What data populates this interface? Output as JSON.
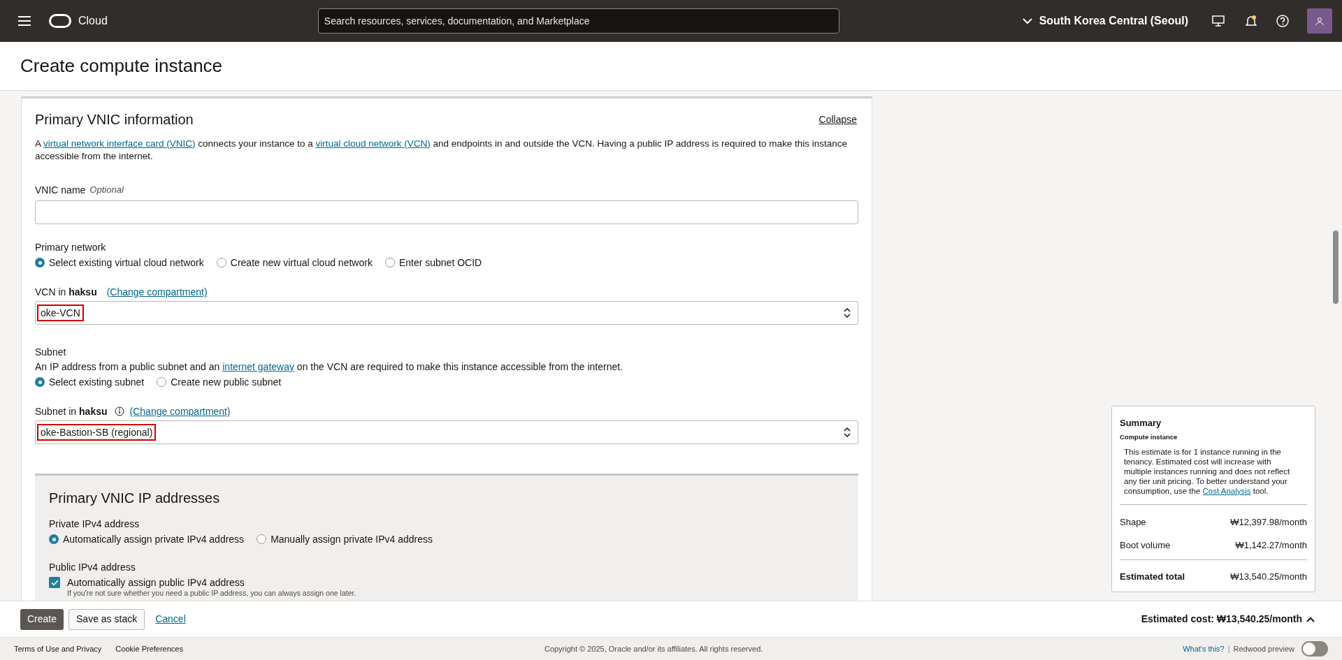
{
  "top_bar": {
    "brand": "Cloud",
    "search": {
      "placeholder": "Search resources, services, documentation, and Marketplace"
    },
    "region": "South Korea Central (Seoul)"
  },
  "page_title": "Create compute instance",
  "vnic_card": {
    "title": "Primary VNIC information",
    "collapse_link": "Collapse",
    "description": [
      {
        "text": "A ",
        "link": false
      },
      {
        "text": "virtual network interface card (VNIC)",
        "link": true
      },
      {
        "text": " connects your instance to a ",
        "link": false
      },
      {
        "text": "virtual cloud network (VCN)",
        "link": true
      },
      {
        "text": " and endpoints in and outside the VCN. Having a public IP address is required to make this instance accessible from the internet.",
        "link": false
      }
    ],
    "vnic_name": {
      "label": "VNIC name",
      "optional": "Optional"
    },
    "primary_network": {
      "label": "Primary network",
      "options": [
        {
          "label": "Select existing virtual cloud network",
          "selected": true
        },
        {
          "label": "Create new virtual cloud network",
          "selected": false
        },
        {
          "label": "Enter subnet OCID",
          "selected": false
        }
      ]
    },
    "vcn": {
      "label_prefix": "VCN in",
      "compartment": "haksu",
      "change_link": "(Change compartment)",
      "value": "oke-VCN",
      "highlighted": true
    },
    "subnet": {
      "label": "Subnet",
      "description": [
        {
          "text": "An IP address from a public subnet and an ",
          "link": false
        },
        {
          "text": "internet gateway",
          "link": true
        },
        {
          "text": " on the VCN are required to make this instance accessible from the internet.",
          "link": false
        }
      ],
      "options": [
        {
          "label": "Select existing subnet",
          "selected": true
        },
        {
          "label": "Create new public subnet",
          "selected": false
        }
      ]
    },
    "subnet_select": {
      "label_prefix": "Subnet in",
      "compartment": "haksu",
      "change_link": "(Change compartment)",
      "value": "oke-Bastion-SB (regional)",
      "highlighted": true
    },
    "ip_section": {
      "title": "Primary VNIC IP addresses",
      "private": {
        "label": "Private IPv4 address",
        "options": [
          {
            "label": "Automatically assign private IPv4 address",
            "selected": true
          },
          {
            "label": "Manually assign private IPv4 address",
            "selected": false
          }
        ]
      },
      "public": {
        "label": "Public IPv4 address",
        "checkbox": {
          "label": "Automatically assign public IPv4 address",
          "checked": true
        },
        "hint": "If you're not sure whether you need a public IP address, you can always assign one later."
      }
    }
  },
  "summary": {
    "title": "Summary",
    "subtitle": "Compute instance",
    "description": [
      {
        "text": "This estimate is for 1 instance running in the tenancy. Estimated cost will increase with multiple instances running and does not reflect any tier unit pricing. To better understand your consumption, use the ",
        "link": false
      },
      {
        "text": "Cost Analysis",
        "link": true
      },
      {
        "text": " tool.",
        "link": false
      }
    ],
    "rows": [
      {
        "label": "Shape",
        "value": "₩12,397.98/month"
      },
      {
        "label": "Boot volume",
        "value": "₩1,142.27/month"
      }
    ],
    "total": {
      "label": "Estimated total",
      "value": "₩13,540.25/month"
    }
  },
  "actions": {
    "buttons": [
      {
        "label": "Create",
        "kind": "primary"
      },
      {
        "label": "Save as stack",
        "kind": "secondary"
      },
      {
        "label": "Cancel",
        "kind": "link"
      }
    ],
    "estimated_cost": "Estimated cost: ₩13,540.25/month"
  },
  "footer": {
    "links": [
      "Terms of Use and Privacy",
      "Cookie Preferences"
    ],
    "copyright": "Copyright © 2025, Oracle and/or its affiliates. All rights reserved.",
    "whats_this": "What's this?",
    "separator": "|",
    "redwood": {
      "label": "Redwood preview",
      "on": false
    }
  }
}
